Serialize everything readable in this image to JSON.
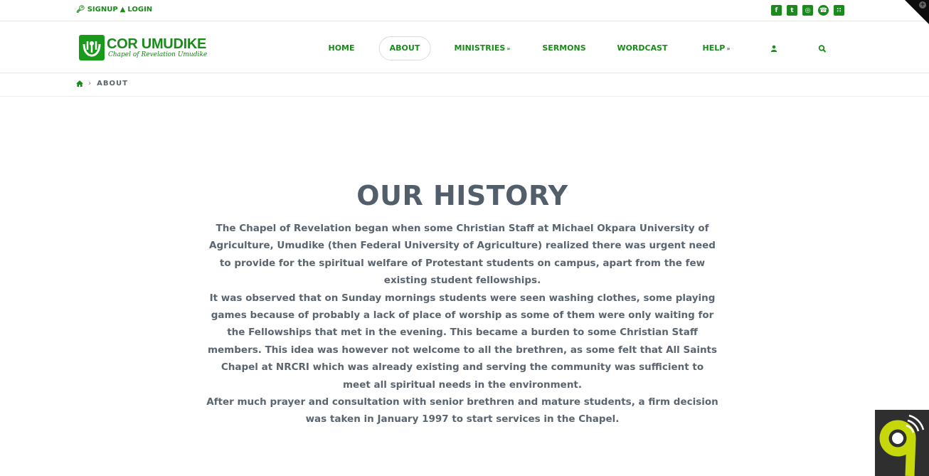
{
  "topbar": {
    "signup_label": "SIGNUP",
    "login_label": "LOGIN",
    "socials": [
      "facebook-icon",
      "twitter-icon",
      "instagram-icon",
      "whatsapp-icon",
      "rss-icon"
    ]
  },
  "logo": {
    "title": "COR UMUDIKE",
    "subtitle": "Chapel of Revelation Umudike"
  },
  "nav": {
    "home": "HOME",
    "about": "ABOUT",
    "ministries": "MINISTRIES",
    "sermons": "SERMONS",
    "wordcast": "WORDCAST",
    "help": "HELP"
  },
  "breadcrumb": {
    "current": "ABOUT"
  },
  "content": {
    "title": "OUR HISTORY",
    "paragraphs": [
      "The Chapel of Revelation began when some Christian Staff at Michael Okpara University of Agriculture, Umudike (then Federal University of Agriculture) realized there was urgent need to provide for the spiritual welfare of Protestant students on campus, apart from the few existing student fellowships.",
      "It was observed that on Sunday mornings students were seen washing clothes, some playing games because of probably a lack of place of worship as some of them were only waiting for the Fellowships that met in the evening. This became a burden to some Christian Staff members. This idea was however not welcome to all the brethren, as some felt that All Saints Chapel at NRCRI which was already existing and serving the community was sufficient to meet all spiritual needs in the environment.",
      "After much prayer and consultation with senior brethren and mature students, a firm decision was taken in January 1997 to start services in the Chapel."
    ]
  },
  "colors": {
    "brand_green": "#1a8a1a",
    "text_gray": "#5a6570",
    "title_gray": "#525e6a"
  }
}
